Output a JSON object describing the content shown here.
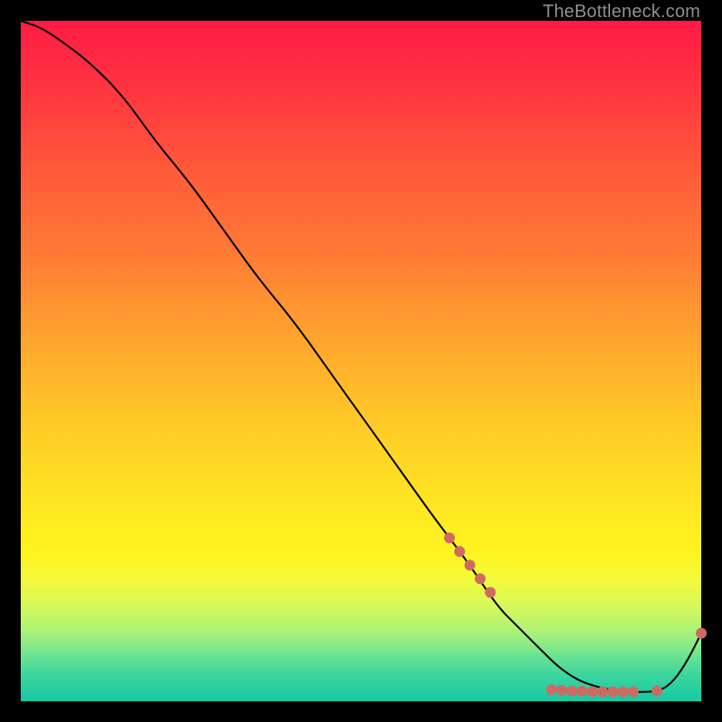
{
  "watermark": "TheBottleneck.com",
  "chart_data": {
    "type": "line",
    "title": "",
    "xlabel": "",
    "ylabel": "",
    "xlim": [
      0,
      100
    ],
    "ylim": [
      0,
      100
    ],
    "grid": false,
    "series": [
      {
        "name": "curve",
        "color": "#000000",
        "stroke_width": 2,
        "x": [
          0,
          3,
          6,
          10,
          15,
          20,
          25,
          30,
          35,
          40,
          45,
          50,
          55,
          60,
          63,
          66,
          70,
          73,
          76,
          79,
          82,
          85,
          88,
          91,
          94,
          96,
          98,
          100
        ],
        "values": [
          100,
          99,
          97,
          94,
          89,
          82,
          76,
          69,
          62,
          56,
          49,
          42,
          35,
          28,
          24,
          20,
          14,
          11,
          8,
          5,
          3,
          2,
          1.5,
          1.3,
          1.5,
          3,
          6,
          10
        ]
      }
    ],
    "markers": [
      {
        "name": "dots",
        "color": "#cf6a63",
        "radius": 6,
        "points": [
          {
            "x": 63,
            "y": 24
          },
          {
            "x": 64.5,
            "y": 22
          },
          {
            "x": 66,
            "y": 20
          },
          {
            "x": 67.5,
            "y": 18
          },
          {
            "x": 69,
            "y": 16
          },
          {
            "x": 78,
            "y": 1.7
          },
          {
            "x": 79.5,
            "y": 1.6
          },
          {
            "x": 81,
            "y": 1.5
          },
          {
            "x": 82.5,
            "y": 1.5
          },
          {
            "x": 84,
            "y": 1.4
          },
          {
            "x": 85.5,
            "y": 1.4
          },
          {
            "x": 87,
            "y": 1.4
          },
          {
            "x": 88.5,
            "y": 1.4
          },
          {
            "x": 90,
            "y": 1.4
          },
          {
            "x": 93.5,
            "y": 1.5
          },
          {
            "x": 100,
            "y": 10
          }
        ]
      }
    ]
  }
}
